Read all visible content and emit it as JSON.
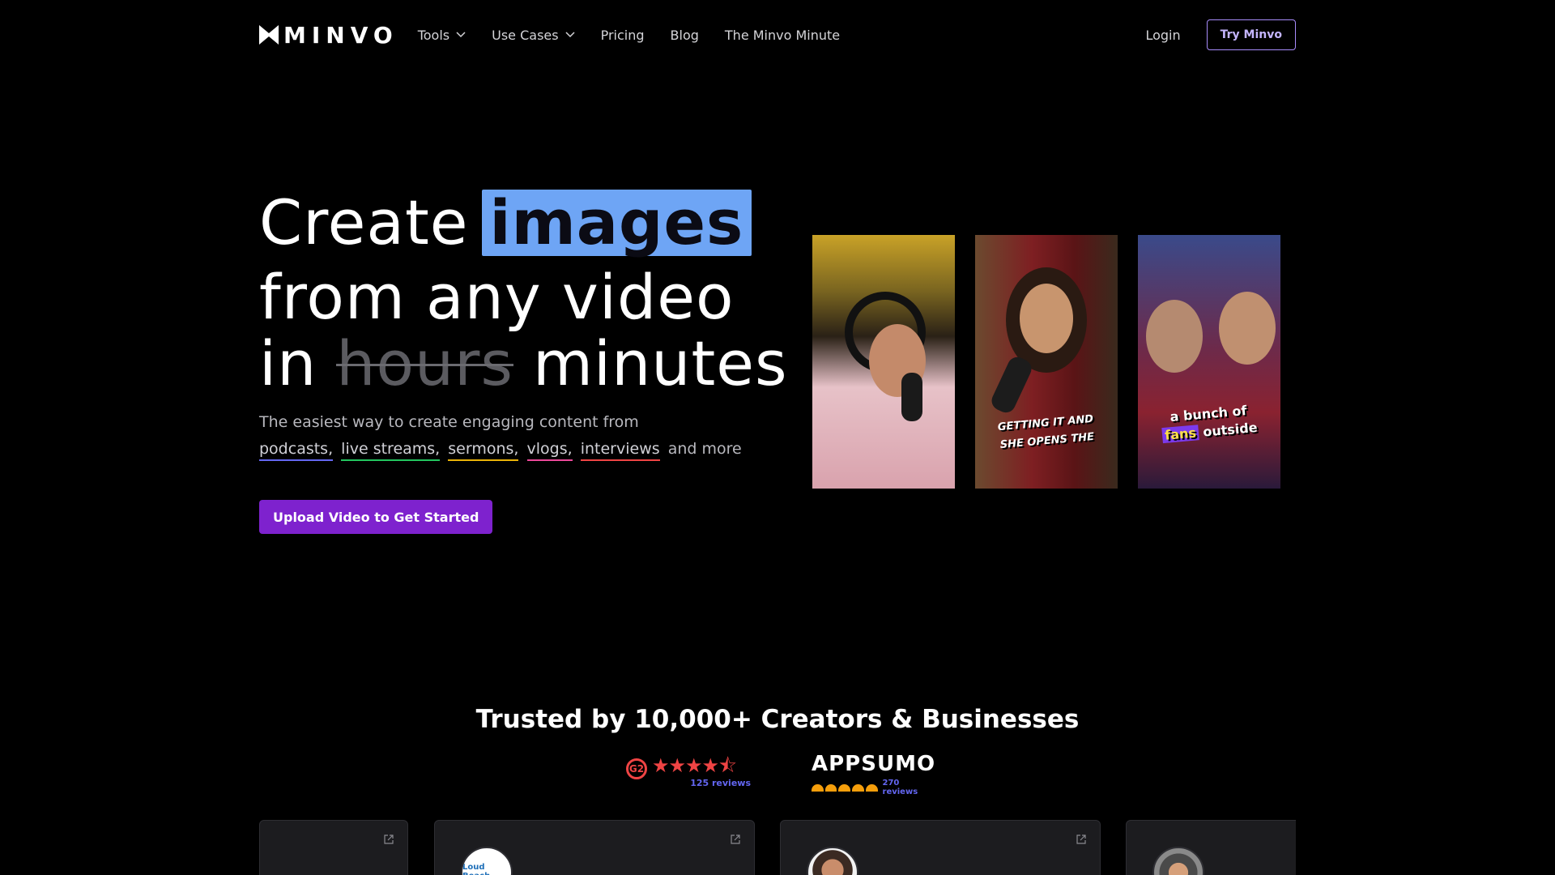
{
  "nav": {
    "logo_text": "MINVO",
    "links": [
      {
        "label": "Tools",
        "dropdown": true
      },
      {
        "label": "Use Cases",
        "dropdown": true
      },
      {
        "label": "Pricing",
        "dropdown": false
      },
      {
        "label": "Blog",
        "dropdown": false
      },
      {
        "label": "The Minvo Minute",
        "dropdown": false
      }
    ],
    "login": "Login",
    "try": "Try Minvo"
  },
  "hero": {
    "word_create": "Create",
    "word_highlight": "images",
    "line2": "from any video",
    "word_in": "in",
    "word_struck": "hours",
    "word_minutes": "minutes",
    "subtitle": "The easiest way to create engaging content from",
    "chips": [
      "podcasts,",
      "live streams,",
      "sermons,",
      "vlogs,",
      "interviews"
    ],
    "and_more": "and more",
    "cta": "Upload Video to Get Started",
    "highlight_color": "#6ea5f5",
    "cta_color": "#7e22ce"
  },
  "thumbs": [
    {
      "caption": ""
    },
    {
      "caption_line1": "GETTING IT AND",
      "caption_line2": "SHE OPENS THE"
    },
    {
      "caption_line1": "a bunch of",
      "caption_fans": "fans",
      "caption_outside": "outside"
    }
  ],
  "trust": {
    "title": "Trusted by 10,000+ Creators & Businesses",
    "g2_logo": "G2",
    "g2_stars": "★★★★⯪",
    "g2_reviews": "125 reviews",
    "appsumo": "APPSUMO",
    "appsumo_reviews": "270 reviews"
  },
  "cards": [
    {
      "avatar": "",
      "icon": "external-link-icon"
    },
    {
      "avatar": "Loud Beach",
      "icon": "external-link-icon"
    },
    {
      "avatar": "",
      "icon": "external-link-icon"
    },
    {
      "avatar": "",
      "icon": "external-link-icon"
    }
  ]
}
